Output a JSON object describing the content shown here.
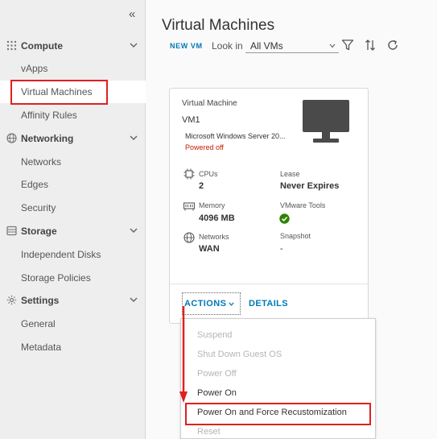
{
  "sidebar": {
    "collapse_glyph": "«",
    "sections": [
      {
        "label": "Compute",
        "icon": "grid-icon",
        "items": [
          "vApps",
          "Virtual Machines",
          "Affinity Rules"
        ]
      },
      {
        "label": "Networking",
        "icon": "globe-icon",
        "items": [
          "Networks",
          "Edges",
          "Security"
        ]
      },
      {
        "label": "Storage",
        "icon": "storage-icon",
        "items": [
          "Independent Disks",
          "Storage Policies"
        ]
      },
      {
        "label": "Settings",
        "icon": "gear-icon",
        "items": [
          "General",
          "Metadata"
        ]
      }
    ],
    "active_item": "Virtual Machines"
  },
  "main": {
    "title": "Virtual Machines",
    "toolbar": {
      "new_vm": "NEW VM",
      "look_in_label": "Look in",
      "look_in_value": "All VMs",
      "icons": [
        "filter-icon",
        "sort-icon",
        "refresh-icon"
      ]
    }
  },
  "card": {
    "type_label": "Virtual Machine",
    "name": "VM1",
    "os": "Microsoft Windows Server 20...",
    "status": "Powered off",
    "status_color": "#c21d00",
    "properties": [
      {
        "label": "CPUs",
        "value": "2",
        "icon": "cpu-icon"
      },
      {
        "label": "Lease",
        "value": "Never Expires"
      },
      {
        "label": "Memory",
        "value": "4096 MB",
        "icon": "memory-icon"
      },
      {
        "label": "VMware Tools",
        "value_icon": "check-circle-icon"
      },
      {
        "label": "Networks",
        "value": "WAN",
        "icon": "network-icon"
      },
      {
        "label": "Snapshot",
        "value": "-"
      }
    ],
    "actions_label": "ACTIONS",
    "details_label": "DETAILS"
  },
  "menu": {
    "items": [
      {
        "label": "Suspend",
        "enabled": false
      },
      {
        "label": "Shut Down Guest OS",
        "enabled": false
      },
      {
        "label": "Power Off",
        "enabled": false
      },
      {
        "label": "Power On",
        "enabled": true
      },
      {
        "label": "Power On and Force Recustomization",
        "enabled": true,
        "highlighted": true
      },
      {
        "label": "Reset",
        "enabled": false
      }
    ]
  },
  "colors": {
    "accent": "#0079b8",
    "annotation": "#e02020",
    "success": "#2f8400"
  }
}
